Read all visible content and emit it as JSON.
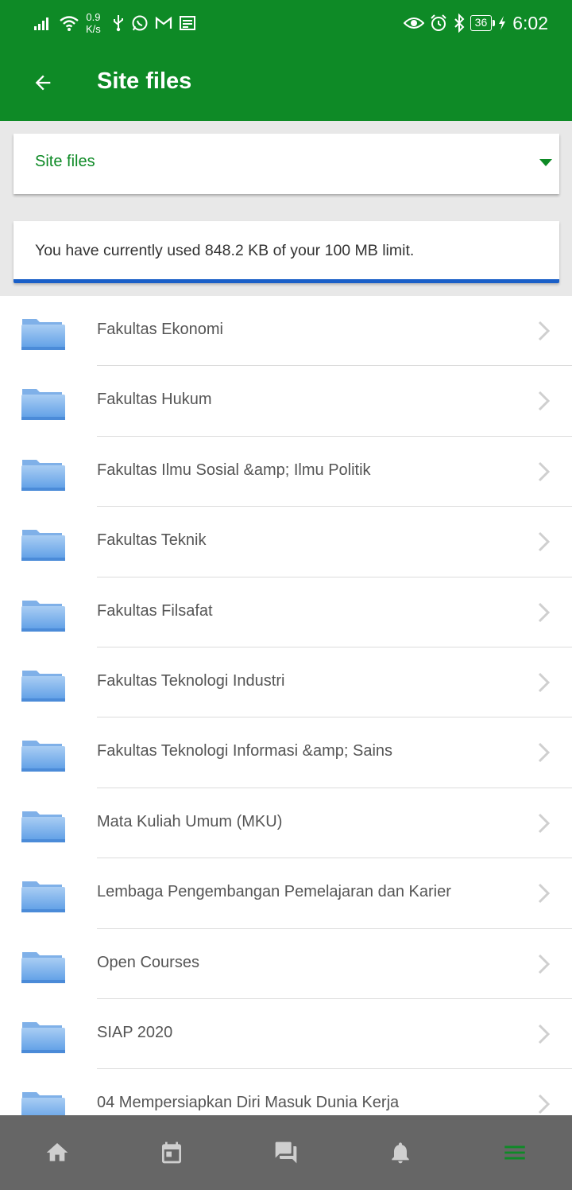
{
  "status_bar": {
    "net_speed_value": "0.9",
    "net_speed_unit": "K/s",
    "battery_level": "36",
    "time": "6:02",
    "icons": [
      "signal-icon",
      "wifi-icon",
      "usb-icon",
      "whatsapp-icon",
      "gmail-icon",
      "news-icon",
      "eye-icon",
      "alarm-icon",
      "bluetooth-icon",
      "battery-icon",
      "charging-icon"
    ]
  },
  "app_bar": {
    "title": "Site files"
  },
  "selector": {
    "selected": "Site files"
  },
  "usage": {
    "text": "You have currently used 848.2 KB of your 100 MB limit."
  },
  "files": [
    {
      "name": "Fakultas Ekonomi"
    },
    {
      "name": "Fakultas Hukum"
    },
    {
      "name": "Fakultas Ilmu Sosial &amp; Ilmu Politik"
    },
    {
      "name": "Fakultas Teknik"
    },
    {
      "name": "Fakultas Filsafat"
    },
    {
      "name": "Fakultas Teknologi Industri"
    },
    {
      "name": "Fakultas Teknologi Informasi &amp; Sains"
    },
    {
      "name": "Mata Kuliah Umum (MKU)"
    },
    {
      "name": "Lembaga Pengembangan Pemelajaran dan Karier"
    },
    {
      "name": "Open Courses"
    },
    {
      "name": "SIAP 2020"
    },
    {
      "name": "04 Mempersiapkan Diri Masuk Dunia Kerja"
    }
  ],
  "bottom_nav": {
    "items": [
      "home-icon",
      "calendar-icon",
      "messages-icon",
      "notifications-icon",
      "menu-icon"
    ],
    "active_index": 4
  },
  "colors": {
    "primary": "#0e8a26",
    "progress_bar": "#1a5fc8",
    "nav_background": "#666666",
    "nav_icon": "#cccccc"
  }
}
